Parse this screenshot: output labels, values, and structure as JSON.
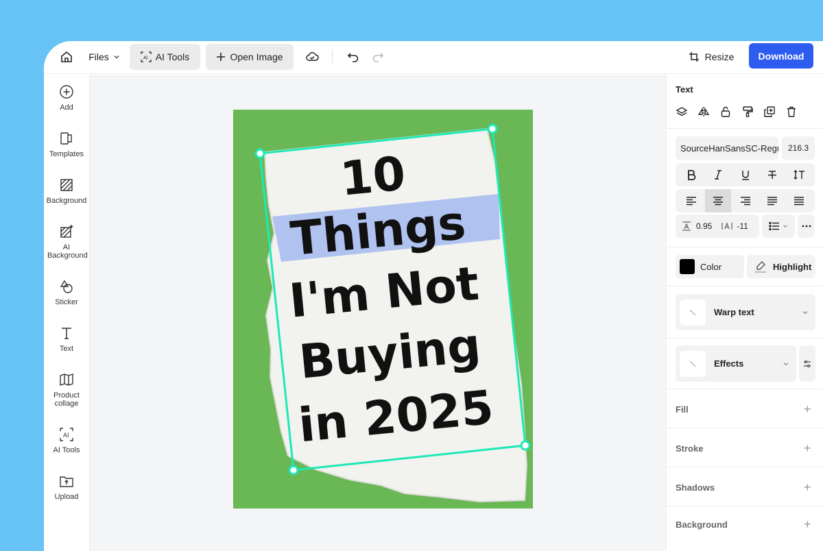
{
  "topbar": {
    "files_label": "Files",
    "ai_tools_label": "AI Tools",
    "open_image_label": "Open Image",
    "resize_label": "Resize",
    "download_label": "Download"
  },
  "sidebar": {
    "items": [
      {
        "label": "Add",
        "icon": "plus-circle-icon"
      },
      {
        "label": "Templates",
        "icon": "templates-icon"
      },
      {
        "label": "Background",
        "icon": "background-icon"
      },
      {
        "label": "AI Background",
        "icon": "ai-background-icon"
      },
      {
        "label": "Sticker",
        "icon": "sticker-icon"
      },
      {
        "label": "Text",
        "icon": "text-icon"
      },
      {
        "label": "Product collage",
        "icon": "map-icon"
      },
      {
        "label": "AI Tools",
        "icon": "ai-icon"
      },
      {
        "label": "Upload",
        "icon": "upload-icon"
      }
    ]
  },
  "canvas": {
    "text_lines": [
      "10",
      "Things",
      "I'm Not",
      "Buying",
      "in 2025"
    ],
    "background_color": "#6ab755",
    "selection_color": "#1de9b6",
    "highlight_color": "#a9bdf0"
  },
  "panel": {
    "title": "Text",
    "font_name": "SourceHanSansSC-Regular",
    "font_size": "216.3",
    "line_spacing": "0.95",
    "letter_spacing": "-11",
    "color_label": "Color",
    "highlight_label": "Highlight",
    "warp_label": "Warp text",
    "effects_label": "Effects",
    "sections": [
      "Fill",
      "Stroke",
      "Shadows",
      "Background"
    ]
  },
  "colors": {
    "accent": "#2f5cf0",
    "page_bg": "#67c2f6"
  }
}
